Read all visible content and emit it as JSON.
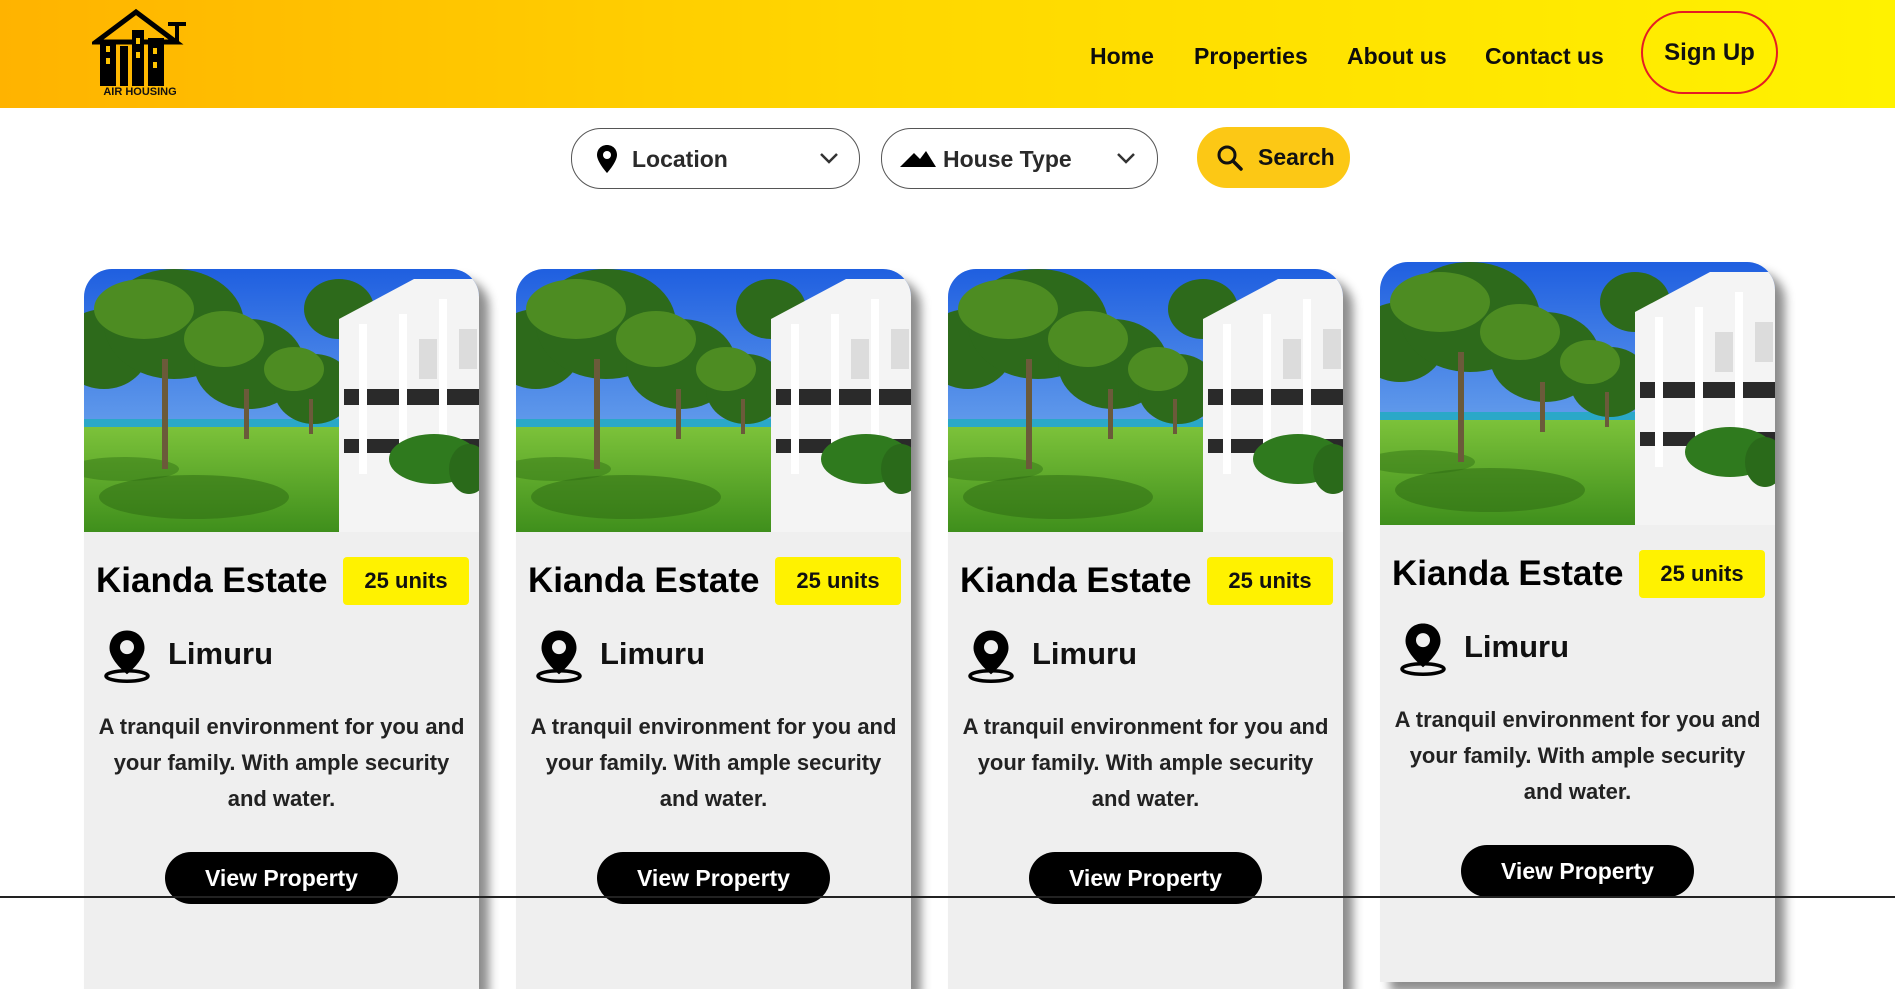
{
  "brand": {
    "logo_text": "AIR HOUSING",
    "accent_color": "#fcc815",
    "highlight_color": "#fff200"
  },
  "nav": {
    "links": [
      {
        "label": "Home"
      },
      {
        "label": "Properties"
      },
      {
        "label": "About us"
      },
      {
        "label": "Contact us"
      }
    ],
    "signup_label": "Sign Up"
  },
  "filters": {
    "location": {
      "label": "Location",
      "icon": "map-pin-icon"
    },
    "house_type": {
      "label": "House Type",
      "icon": "house-roof-icon"
    },
    "search_label": "Search"
  },
  "properties": [
    {
      "name": "Kianda Estate",
      "units": "25 units",
      "location": "Limuru",
      "description": "A tranquil environment for you and your family. With ample security and water.",
      "button": "View Property"
    },
    {
      "name": "Kianda Estate",
      "units": "25 units",
      "location": "Limuru",
      "description": "A tranquil environment for you and your family. With ample security and water.",
      "button": "View Property"
    },
    {
      "name": "Kianda Estate",
      "units": "25 units",
      "location": "Limuru",
      "description": "A tranquil environment for you and your family. With ample security and water.",
      "button": "View Property"
    },
    {
      "name": "Kianda Estate",
      "units": "25 units",
      "location": "Limuru",
      "description": "A tranquil environment for you and your family. With ample security and water.",
      "button": "View Property"
    }
  ]
}
